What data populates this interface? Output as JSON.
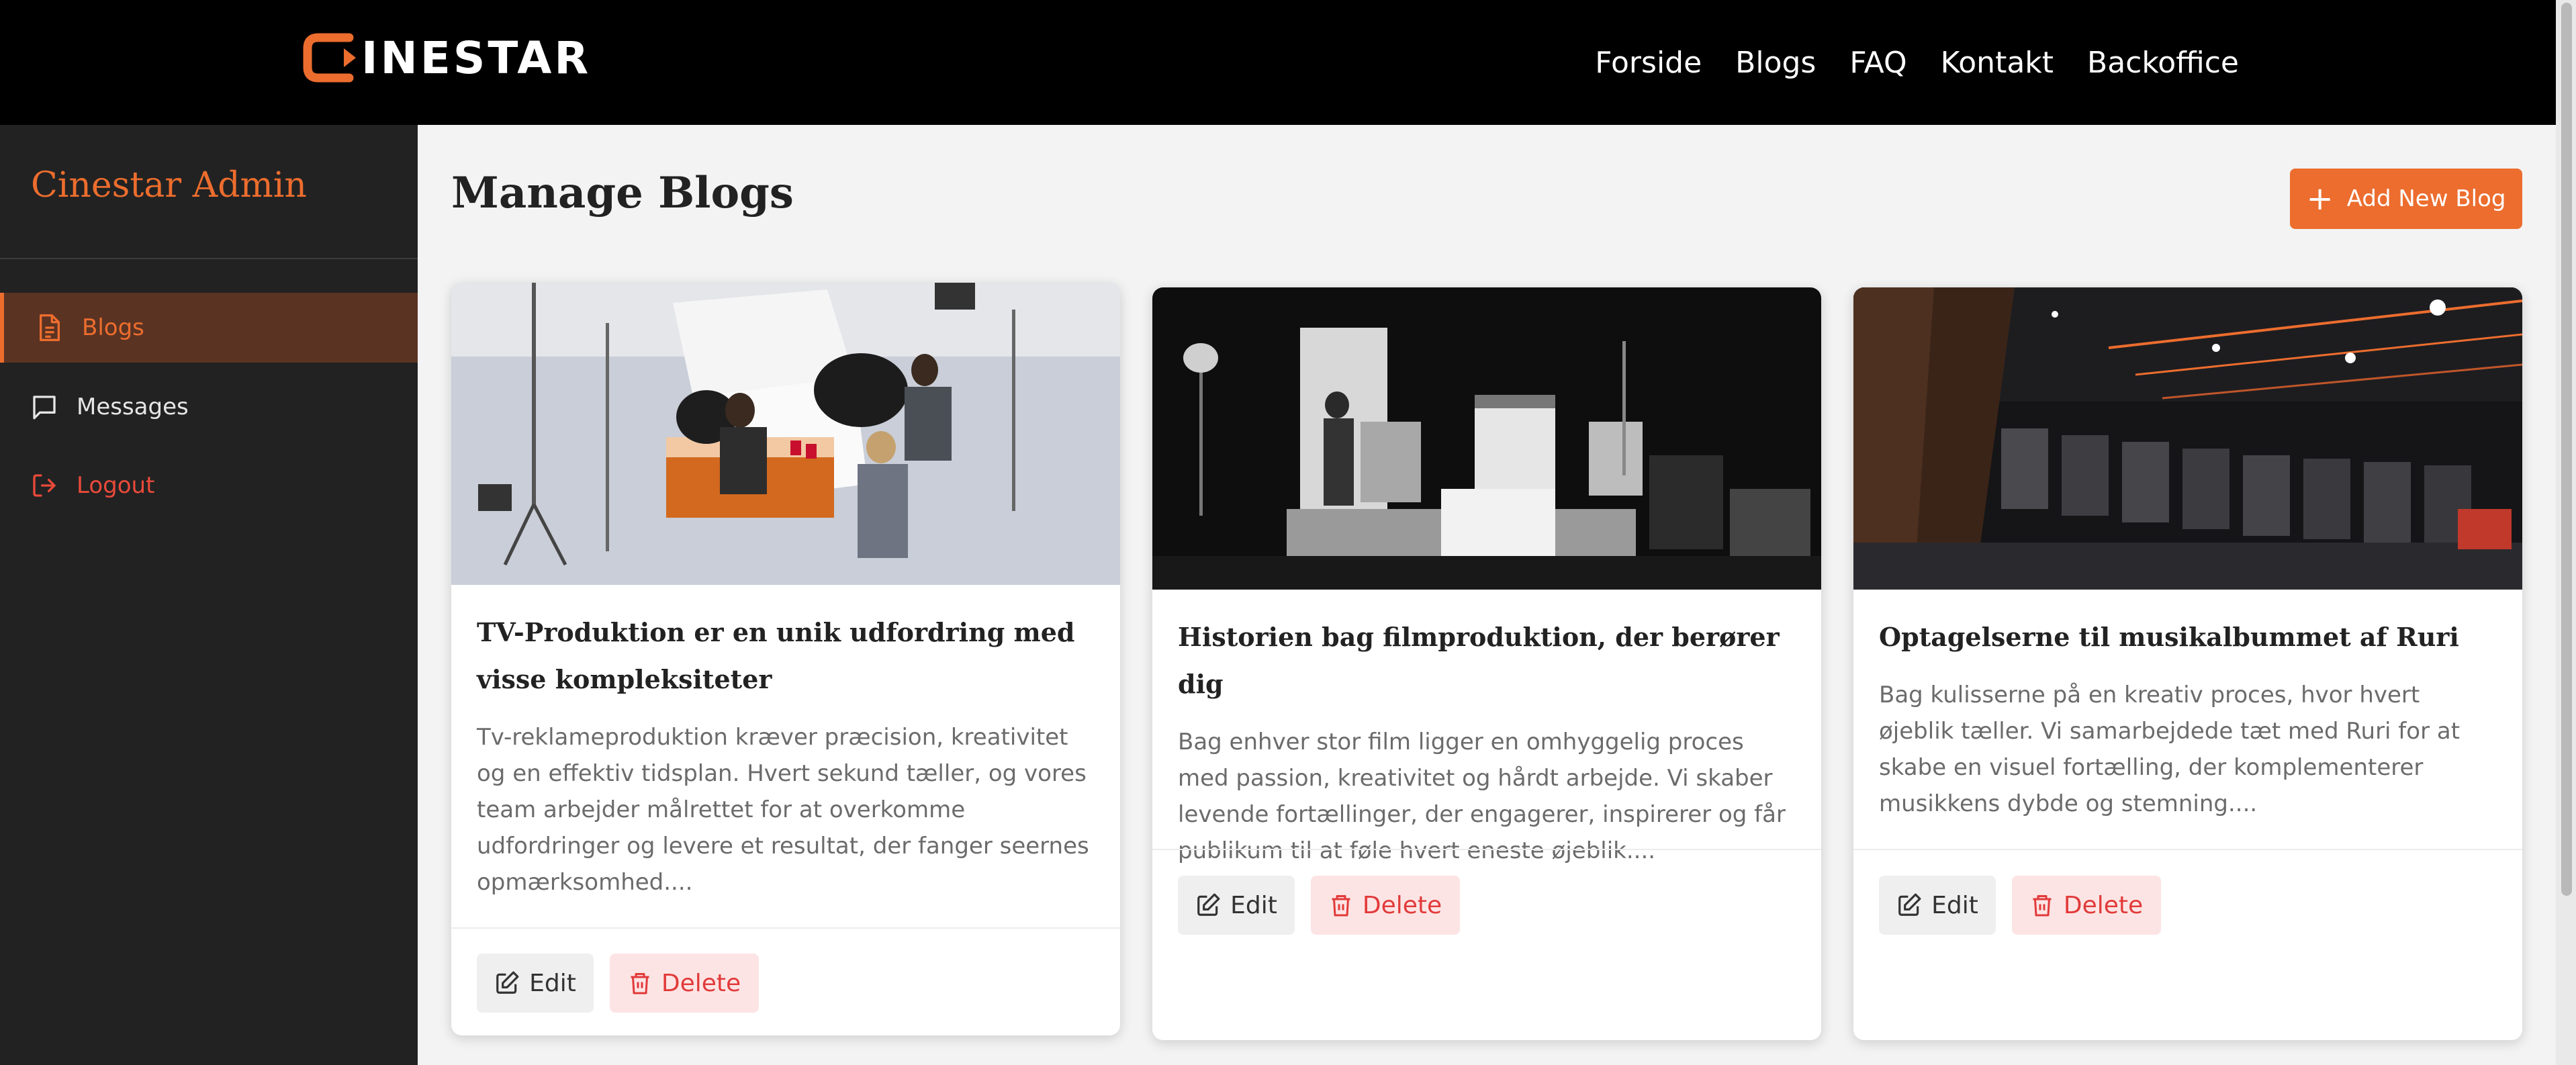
{
  "brand": {
    "name": "INESTAR",
    "accent": "#ec6d2e"
  },
  "nav": [
    {
      "label": "Forside"
    },
    {
      "label": "Blogs"
    },
    {
      "label": "FAQ"
    },
    {
      "label": "Kontakt"
    },
    {
      "label": "Backoffice"
    }
  ],
  "sidebar": {
    "title": "Cinestar Admin",
    "items": [
      {
        "label": "Blogs",
        "icon": "document-icon",
        "active": true
      },
      {
        "label": "Messages",
        "icon": "chat-icon"
      },
      {
        "label": "Logout",
        "icon": "logout-icon"
      }
    ]
  },
  "main": {
    "title": "Manage Blogs",
    "add_label": "Add New Blog",
    "add_icon": "plus-icon",
    "cards": [
      {
        "title": "TV-Produktion er en unik udfordring med visse kompleksiteter",
        "excerpt": "Tv-reklameproduktion kræver præcision, kreativitet og en effektiv tidsplan. Hvert sekund tæller, og vores team arbejder målrettet for at overkomme udfordringer og levere et resultat, der fanger seernes opmærksomhed....",
        "image": "photo studio production",
        "edit_label": "Edit",
        "delete_label": "Delete"
      },
      {
        "title": "Historien bag filmproduktion, der berører dig",
        "excerpt": "Bag enhver stor film ligger en omhyggelig proces med passion, kreativitet og hårdt arbejde. Vi skaber levende fortællinger, der engagerer, inspirerer og får publikum til at føle hvert eneste øjeblik....",
        "image": "black and white film set",
        "edit_label": "Edit",
        "delete_label": "Delete"
      },
      {
        "title": "Optagelserne til musikalbummet af Ruri",
        "excerpt": "Bag kulisserne på en kreativ proces, hvor hvert øjeblik tæller. Vi samarbejdede tæt med Ruri for at skabe en visuel fortælling, der komplementerer musikkens dybde og stemning....",
        "image": "dark gym interior",
        "edit_label": "Edit",
        "delete_label": "Delete"
      }
    ]
  },
  "colors": {
    "delete_text": "#e23a3a",
    "delete_bg": "#fde4e4",
    "sidebar_bg": "#222222",
    "active_bg": "#5a3322"
  }
}
